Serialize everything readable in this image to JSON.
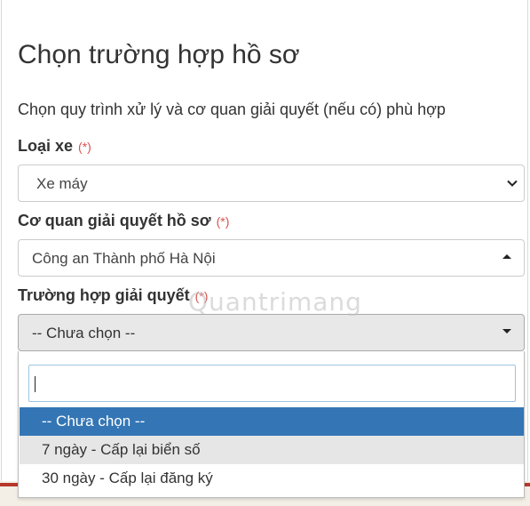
{
  "form": {
    "title": "Chọn trường hợp hồ sơ",
    "description": "Chọn quy trình xử lý và cơ quan giải quyết (nếu có) phù hợp",
    "vehicle_type": {
      "label": "Loại xe",
      "required_mark": "(*)",
      "value": "Xe máy"
    },
    "authority": {
      "label": "Cơ quan giải quyết hồ sơ",
      "required_mark": "(*)",
      "value": "Công an Thành phố Hà Nội"
    },
    "case": {
      "label": "Trường hợp giải quyết",
      "required_mark": "(*)",
      "value": "-- Chưa chọn --"
    }
  },
  "dropdown": {
    "search_value": "",
    "options": [
      {
        "label": "-- Chưa chọn --",
        "state": "selected"
      },
      {
        "label": "7 ngày - Cấp lại biển số",
        "state": "hover"
      },
      {
        "label": "30 ngày - Cấp lại đăng ký",
        "state": "normal"
      }
    ]
  },
  "watermark": "Quantrimang",
  "colors": {
    "selected_option": "#3476b5",
    "required_mark": "#d9534f",
    "bottom_stripe": "#b7372b"
  }
}
